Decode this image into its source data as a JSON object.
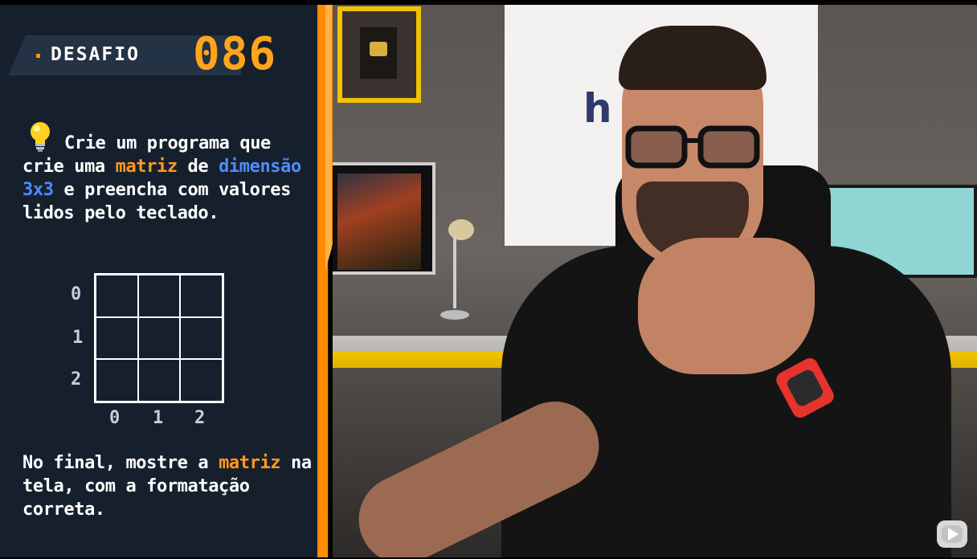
{
  "challenge": {
    "banner_label": "DESAFIO",
    "banner_number": "086",
    "prompt": {
      "part1": "Crie um programa que crie uma ",
      "highlight1": "matriz",
      "part2": " de ",
      "highlight2": "dimensão 3x3",
      "part3": " e preencha com valores lidos pelo teclado."
    },
    "matrix": {
      "row_labels": [
        "0",
        "1",
        "2"
      ],
      "col_labels": [
        "0",
        "1",
        "2"
      ]
    },
    "footer": {
      "part1": "No final, mostre a ",
      "highlight": "matriz",
      "part2": " na tela, com a formatação correta."
    }
  },
  "scene": {
    "wall_logo_text": "h"
  },
  "colors": {
    "panel_bg": "#16202d",
    "accent_orange": "#ff9a1e",
    "accent_blue": "#4e8cff",
    "divider_orange": "#ff8c00"
  },
  "icons": {
    "bulb": "lightbulb-icon",
    "player": "youtube-play-icon"
  }
}
